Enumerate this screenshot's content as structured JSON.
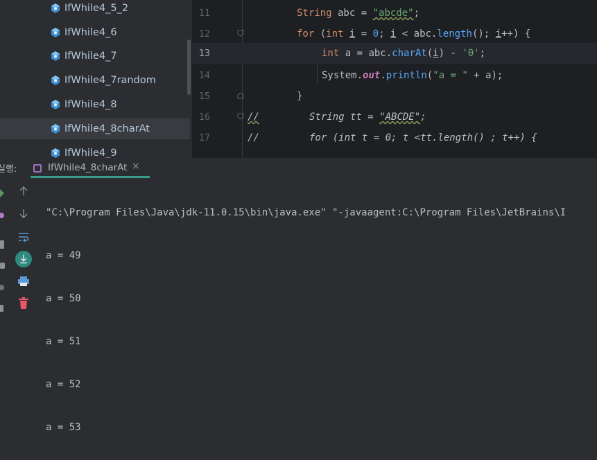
{
  "project_tree": {
    "items": [
      {
        "label": "IfWhile4_5_2"
      },
      {
        "label": "IfWhile4_6"
      },
      {
        "label": "IfWhile4_7"
      },
      {
        "label": "IfWhile4_7random"
      },
      {
        "label": "IfWhile4_8"
      },
      {
        "label": "IfWhile4_8charAt",
        "selected": true
      },
      {
        "label": "IfWhile4_9"
      }
    ]
  },
  "editor": {
    "line_numbers": [
      "11",
      "12",
      "13",
      "14",
      "15",
      "16",
      "17"
    ],
    "current_line": "13",
    "lines": {
      "l11": {
        "type": "String",
        "rest": " abc = ",
        "value": "\"abcde\"",
        "end": ";"
      },
      "l12": {
        "for": "for",
        "open": " (",
        "int": "int",
        "sp": " ",
        "i1": "i",
        "eq": " = ",
        "zero": "0",
        "semi": "; ",
        "i2": "i",
        "lt": " < abc.",
        "length": "length",
        "call": "(); ",
        "i3": "i",
        "inc": "++) {"
      },
      "l13": {
        "int": "int",
        "rest": " a = abc.",
        "charAt": "charAt",
        "po": "(",
        "i": "i",
        "pc": ") - ",
        "char": "'0'",
        "end": ";"
      },
      "l14": {
        "system": "System.",
        "out": "out",
        "dot": ".",
        "println": "println",
        "po": "(",
        "str": "\"a = \"",
        "end": " + a);"
      },
      "l15": {
        "brace": "}"
      },
      "l16": {
        "slashes": "//",
        "type": "String",
        "rest": " tt = ",
        "value": "\"ABCDE\"",
        "end": ";"
      },
      "l17": {
        "slashes": "//",
        "text": "for (int t = 0; t <tt.length() ; t++) {"
      }
    }
  },
  "run_window": {
    "label": "실행:",
    "tab_label": "IfWhile4_8charAt",
    "close": "×",
    "console_lines": [
      "\"C:\\Program Files\\Java\\jdk-11.0.15\\bin\\java.exe\" \"-javaagent:C:\\Program Files\\JetBrains\\I",
      "a = 49",
      "a = 50",
      "a = 51",
      "a = 52",
      "a = 53"
    ]
  }
}
